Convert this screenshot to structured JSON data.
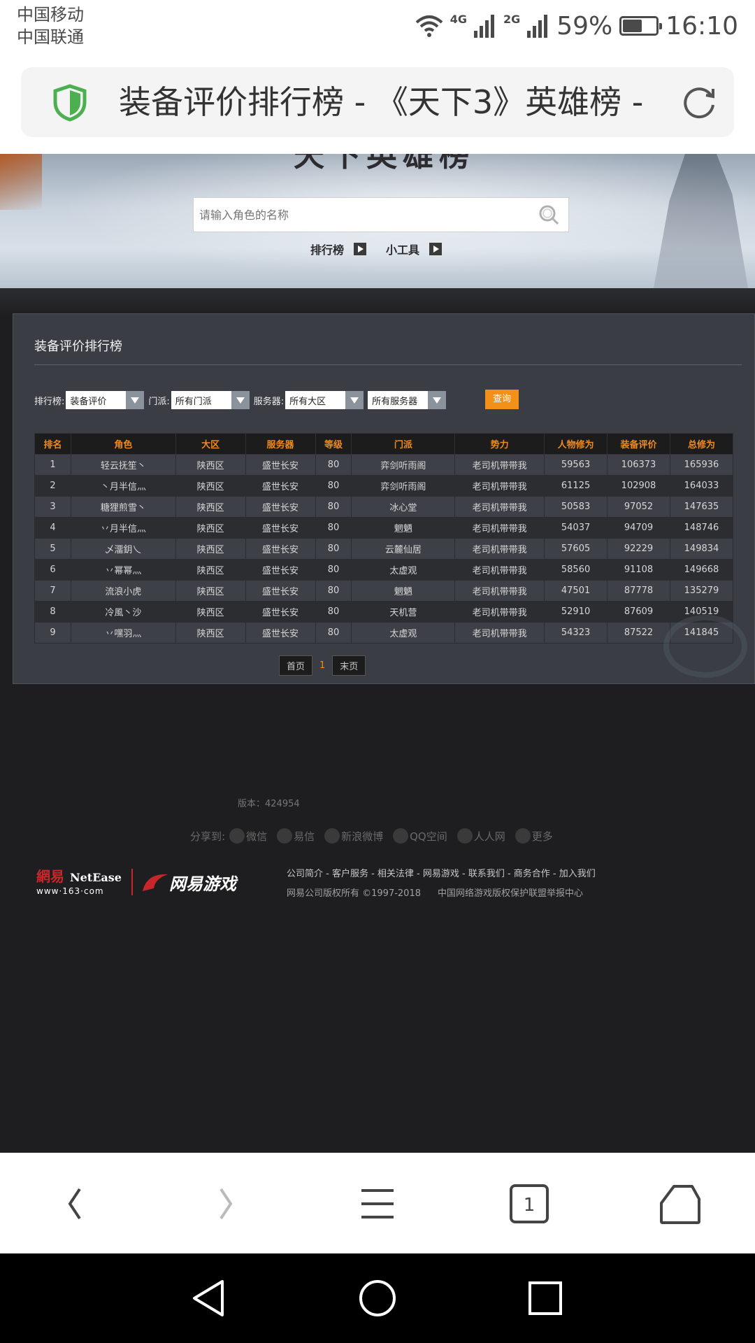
{
  "status_bar": {
    "carrier_1": "中国移动",
    "carrier_2": "中国联通",
    "net_1": "4G",
    "net_2": "2G",
    "battery_percent": "59%",
    "battery_level": 0.59,
    "time": "16:10"
  },
  "url_bar": {
    "title": "装备评价排行榜 - 《天下3》英雄榜 -",
    "secure_icon": "shield-icon",
    "reload_icon": "reload-icon"
  },
  "banner": {
    "logo_text": "天下英雄榜",
    "search_placeholder": "请输入角色的名称",
    "nav": [
      "排行榜",
      "小工具"
    ]
  },
  "panel": {
    "title": "装备评价排行榜",
    "filters": {
      "rank_label": "排行榜:",
      "rank_value": "装备评价",
      "school_label": "门派:",
      "school_value": "所有门派",
      "server_label": "服务器:",
      "region_value": "所有大区",
      "server_value": "所有服务器"
    },
    "query_button": "查询",
    "table": {
      "headers": [
        "排名",
        "角色",
        "大区",
        "服务器",
        "等级",
        "门派",
        "势力",
        "人物修为",
        "装备评价",
        "总修为"
      ],
      "rows": [
        [
          "1",
          "轻云抚笙丶",
          "陕西区",
          "盛世长安",
          "80",
          "弈剑听雨阁",
          "老司机带带我",
          "59563",
          "106373",
          "165936"
        ],
        [
          "2",
          "丶月半信灬",
          "陕西区",
          "盛世长安",
          "80",
          "弈剑听雨阁",
          "老司机带带我",
          "61125",
          "102908",
          "164033"
        ],
        [
          "3",
          "糖狸煎雪丶",
          "陕西区",
          "盛世长安",
          "80",
          "冰心堂",
          "老司机带带我",
          "50583",
          "97052",
          "147635"
        ],
        [
          "4",
          "丷月半信灬",
          "陕西区",
          "盛世长安",
          "80",
          "魍魉",
          "老司机带带我",
          "54037",
          "94709",
          "148746"
        ],
        [
          "5",
          "乄澑鈅乀",
          "陕西区",
          "盛世长安",
          "80",
          "云麓仙居",
          "老司机带带我",
          "57605",
          "92229",
          "149834"
        ],
        [
          "6",
          "丷幂幂灬",
          "陕西区",
          "盛世长安",
          "80",
          "太虚观",
          "老司机带带我",
          "58560",
          "91108",
          "149668"
        ],
        [
          "7",
          "流浪小虎",
          "陕西区",
          "盛世长安",
          "80",
          "魍魉",
          "老司机带带我",
          "47501",
          "87778",
          "135279"
        ],
        [
          "8",
          "冷風丶沙",
          "陕西区",
          "盛世长安",
          "80",
          "天机营",
          "老司机带带我",
          "52910",
          "87609",
          "140519"
        ],
        [
          "9",
          "丷嘿羽灬",
          "陕西区",
          "盛世长安",
          "80",
          "太虚观",
          "老司机带带我",
          "54323",
          "87522",
          "141845"
        ]
      ]
    },
    "pager": {
      "first": "首页",
      "current": "1",
      "last": "末页"
    }
  },
  "footer": {
    "version": "版本：424954",
    "share_label": "分享到:",
    "share_items": [
      "微信",
      "易信",
      "新浪微博",
      "QQ空间",
      "人人网",
      "更多"
    ],
    "logo_netease_cn": "網易",
    "logo_netease_en": "NetEase",
    "logo_url": "www·163·com",
    "logo_games": "网易游戏",
    "links": "公司简介 - 客户服务 - 相关法律 - 网易游戏 - 联系我们 - 商务合作 - 加入我们",
    "copyright": "网易公司版权所有 ©1997-2018",
    "report": "中国网络游戏版权保护联盟举报中心"
  },
  "toolbar": {
    "tab_count": "1",
    "icons": [
      "back-icon",
      "forward-icon",
      "menu-icon",
      "tabs-icon",
      "home-icon"
    ]
  },
  "navbar": {
    "icons": [
      "nav-back-icon",
      "nav-home-icon",
      "nav-recents-icon"
    ]
  },
  "colors": {
    "accent": "#ef8a1f",
    "query_button": "#f39019",
    "panel_bg": "#3a3e44",
    "page_bg": "#1e1e20",
    "secure_green": "#4caf50"
  }
}
